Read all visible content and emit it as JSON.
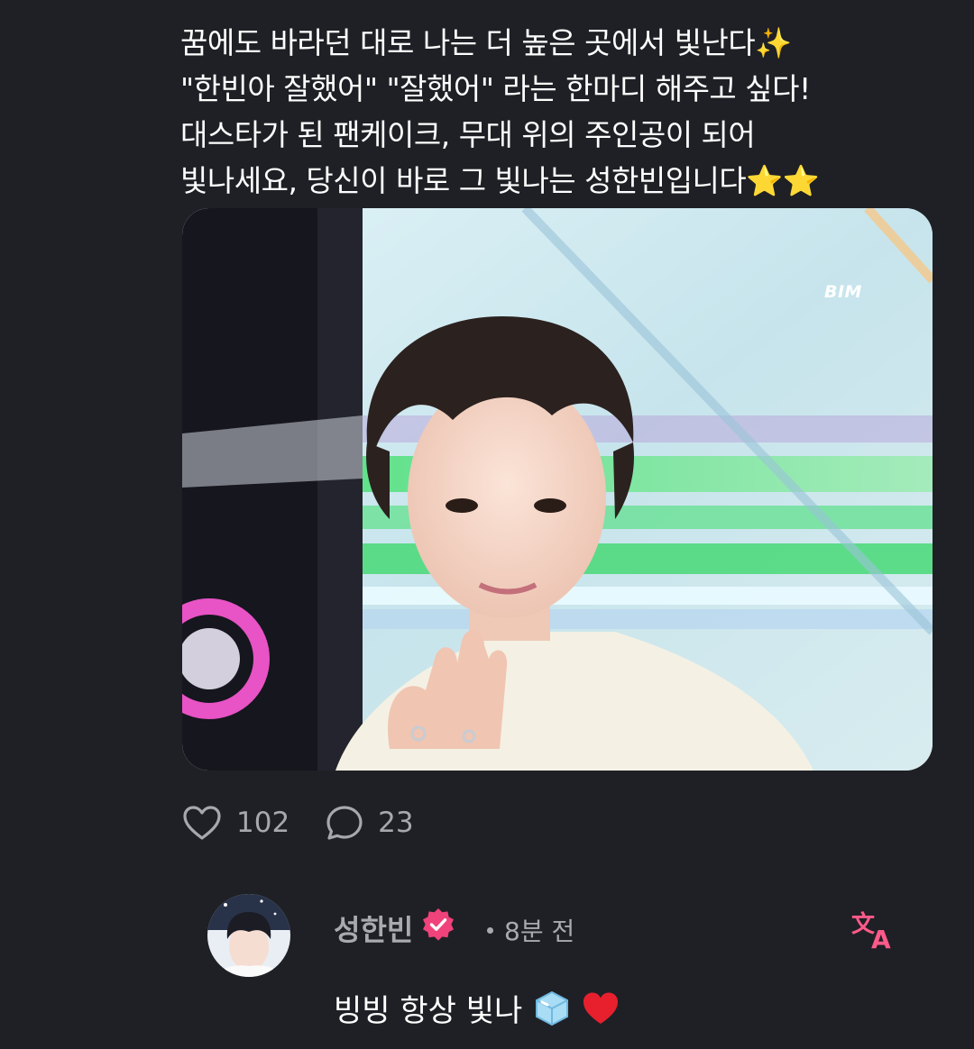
{
  "post": {
    "lines": [
      "꿈에도 바라던 대로 나는 더 높은 곳에서 빛난다✨",
      "\"한빈아 잘했어\" \"잘했어\" 라는 한마디 해주고 싶다!",
      "대스타가 된 팬케이크, 무대 위의 주인공이 되어",
      "빛나세요, 당신이 바로 그 빛나는 성한빈입니다⭐⭐"
    ],
    "image_watermark": "BIM"
  },
  "actions": {
    "likes": "102",
    "comments": "23"
  },
  "comment": {
    "author": "성한빈",
    "time": "8분 전",
    "text": "빙빙 항상 빛나"
  },
  "colors": {
    "background": "#1f2025",
    "muted_text": "#a9aab0",
    "verified_badge": "#f0427b",
    "translate_icon": "#ff5a8a"
  },
  "icons": {
    "like": "heart-outline-icon",
    "comment": "speech-bubble-icon",
    "verified": "verified-badge-icon",
    "translate": "translate-icon"
  }
}
